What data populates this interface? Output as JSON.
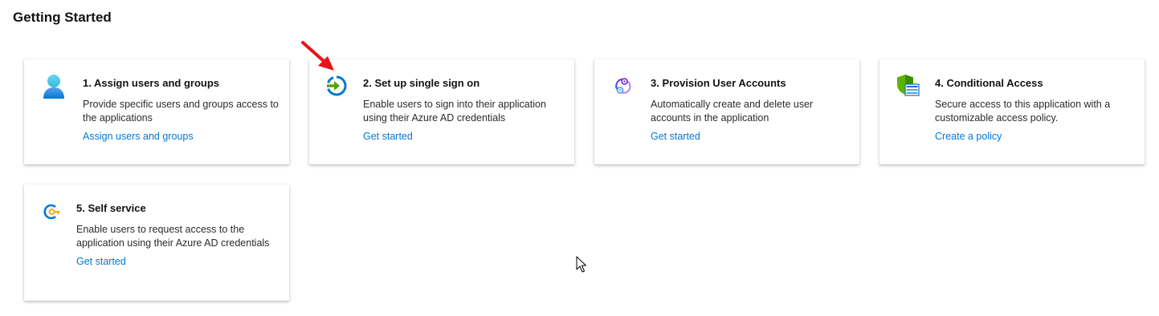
{
  "page": {
    "title": "Getting Started"
  },
  "cards": [
    {
      "title": "1. Assign users and groups",
      "description": "Provide specific users and groups access to the applications",
      "link": "Assign users and groups",
      "icon": "user-icon"
    },
    {
      "title": "2. Set up single sign on",
      "description": "Enable users to sign into their application using their Azure AD credentials",
      "link": "Get started",
      "icon": "single-sign-on-icon"
    },
    {
      "title": "3. Provision User Accounts",
      "description": "Automatically create and delete user accounts in the application",
      "link": "Get started",
      "icon": "provisioning-icon"
    },
    {
      "title": "4. Conditional Access",
      "description": "Secure access to this application with a customizable access policy.",
      "link": "Create a policy",
      "icon": "conditional-access-shield-icon"
    },
    {
      "title": "5. Self service",
      "description": "Enable users to request access to the application using their Azure AD credentials",
      "link": "Get started",
      "icon": "self-service-key-icon"
    }
  ],
  "colors": {
    "link": "#0078d4",
    "annotation_arrow": "#e8141b"
  }
}
